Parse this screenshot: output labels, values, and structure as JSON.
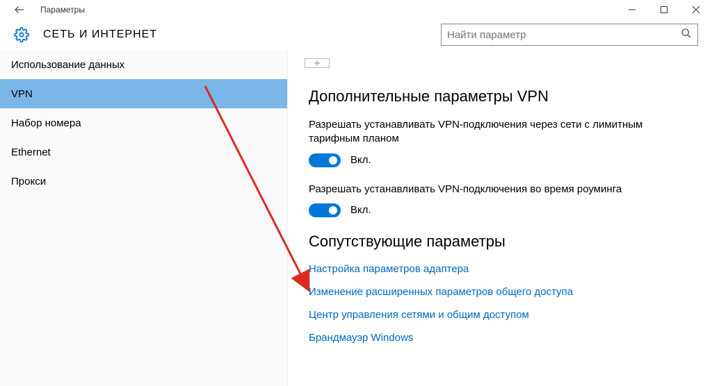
{
  "window": {
    "title": "Параметры"
  },
  "header": {
    "category": "СЕТЬ И ИНТЕРНЕТ"
  },
  "search": {
    "placeholder": "Найти параметр"
  },
  "sidebar": {
    "items": [
      {
        "label": "Использование данных",
        "selected": false
      },
      {
        "label": "VPN",
        "selected": true
      },
      {
        "label": "Набор номера",
        "selected": false
      },
      {
        "label": "Ethernet",
        "selected": false
      },
      {
        "label": "Прокси",
        "selected": false
      }
    ]
  },
  "panel": {
    "section1_title": "Дополнительные параметры VPN",
    "setting1_desc": "Разрешать устанавливать VPN-подключения через сети с лимитным тарифным планом",
    "setting1_state": "Вкл.",
    "setting2_desc": "Разрешать устанавливать VPN-подключения во время роуминга",
    "setting2_state": "Вкл.",
    "section2_title": "Сопутствующие параметры",
    "links": [
      "Настройка параметров адаптера",
      "Изменение расширенных параметров общего доступа",
      "Центр управления сетями и общим доступом",
      "Брандмауэр Windows"
    ]
  },
  "colors": {
    "accent": "#0078d7",
    "link": "#0067c0",
    "selected_bg": "#7ab6e8",
    "arrow": "#d92b1f"
  }
}
